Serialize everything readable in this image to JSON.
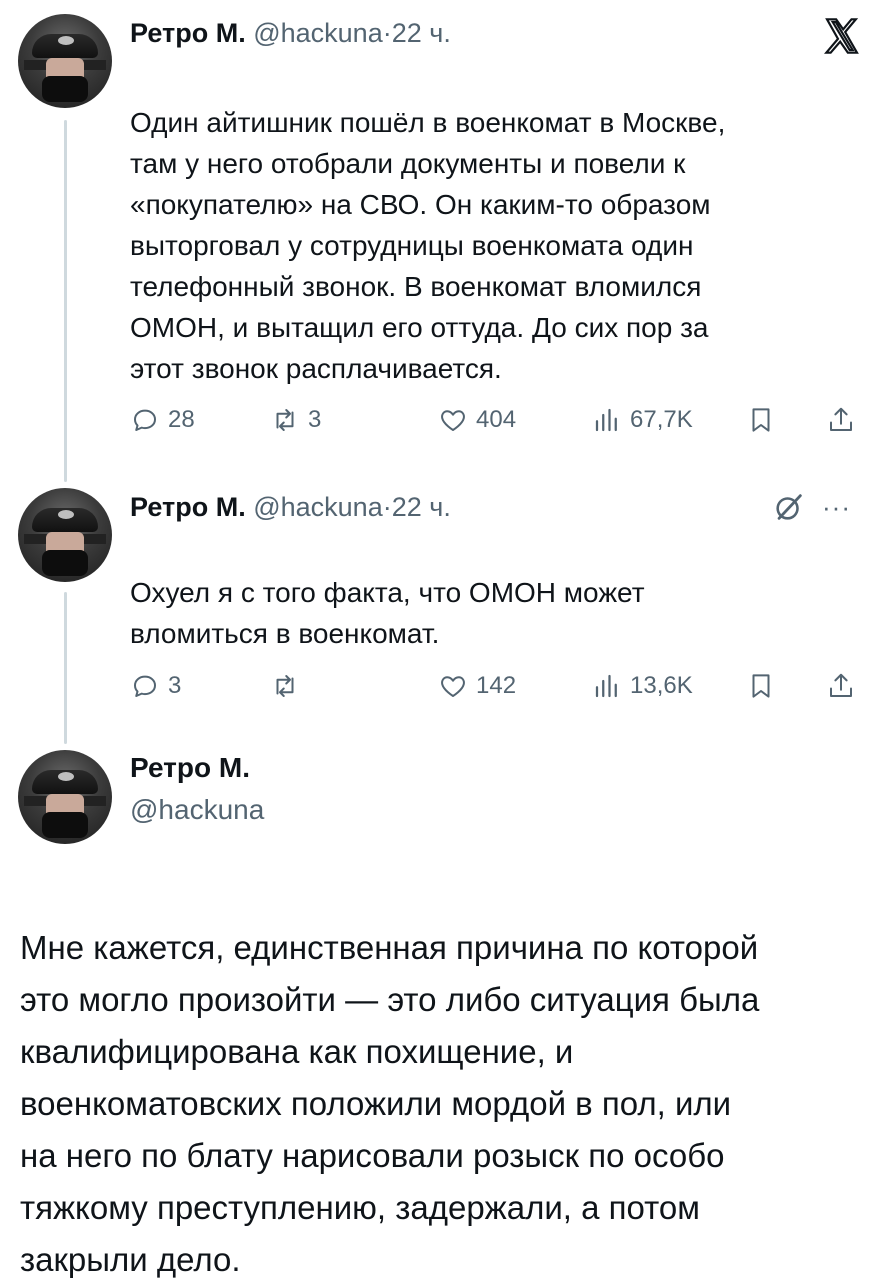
{
  "platform_logo": "x-logo",
  "tweets": [
    {
      "author_name": "Ретро М.",
      "handle": "@hackuna",
      "separator": "·",
      "time": "22 ч.",
      "lines": [
        "Один айтишник пошёл в военкомат в Москве,",
        "там у него отобрали документы и повели к",
        "«покупателю» на СВО. Он каким-то образом",
        "выторговал у сотрудницы военкомата один",
        "телефонный звонок. В военкомат вломился",
        "ОМОН, и вытащил его оттуда. До сих пор за",
        "этот звонок расплачивается."
      ],
      "replies": "28",
      "reposts": "3",
      "likes": "404",
      "views": "67,7K"
    },
    {
      "author_name": "Ретро М.",
      "handle": "@hackuna",
      "separator": "·",
      "time": "22 ч.",
      "lines": [
        "Охуел я с того факта, что ОМОН может",
        "вломиться в военкомат."
      ],
      "replies": "3",
      "reposts": "",
      "likes": "142",
      "views": "13,6K"
    }
  ],
  "reply": {
    "author_name": "Ретро М.",
    "handle": "@hackuna",
    "lines": [
      "Мне кажется, единственная причина по которой",
      "это могло произойти — это либо ситуация была",
      "квалифицирована как похищение, и",
      "военкоматовских положили мордой в пол, или",
      "на него по блату нарисовали розыск по особо",
      "тяжкому преступлению, задержали, а потом",
      "закрыли дело."
    ]
  },
  "icons": {
    "reply": "reply-icon",
    "repost": "repost-icon",
    "like": "heart-icon",
    "views": "views-icon",
    "bookmark": "bookmark-icon",
    "share": "share-icon",
    "grok": "grok-icon",
    "more": "more-icon"
  },
  "colors": {
    "text": "#0f1419",
    "secondary": "#536471",
    "thread_line": "#cfd9de",
    "background": "#ffffff"
  }
}
